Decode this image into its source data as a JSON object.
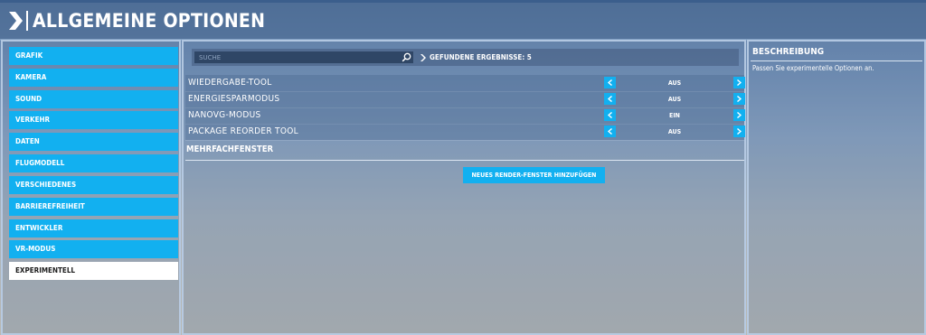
{
  "header": {
    "title": "ALLGEMEINE OPTIONEN"
  },
  "sidebar": {
    "items": [
      {
        "label": "GRAFIK"
      },
      {
        "label": "KAMERA"
      },
      {
        "label": "SOUND"
      },
      {
        "label": "VERKEHR"
      },
      {
        "label": "DATEN"
      },
      {
        "label": "FLUGMODELL"
      },
      {
        "label": "VERSCHIEDENES"
      },
      {
        "label": "BARRIEREFREIHEIT"
      },
      {
        "label": "ENTWICKLER"
      },
      {
        "label": "VR-MODUS"
      },
      {
        "label": "EXPERIMENTELL",
        "active": true
      }
    ]
  },
  "search": {
    "placeholder": "SUCHE",
    "value": "",
    "results_label": "GEFUNDENE ERGEBNISSE: 5"
  },
  "options": [
    {
      "label": "WIEDERGABE-TOOL",
      "value": "AUS"
    },
    {
      "label": "ENERGIESPARMODUS",
      "value": "AUS"
    },
    {
      "label": "NANOVG-MODUS",
      "value": "EIN"
    },
    {
      "label": "PACKAGE REORDER TOOL",
      "value": "AUS"
    }
  ],
  "multiwindow": {
    "section_title": "MEHRFACHFENSTER",
    "add_button_label": "NEUES RENDER-FENSTER HINZUFÜGEN"
  },
  "description": {
    "title": "BESCHREIBUNG",
    "text": "Passen Sie experimentelle Optionen an."
  },
  "colors": {
    "accent": "#12b0f0",
    "active_item": "#ffffff"
  }
}
